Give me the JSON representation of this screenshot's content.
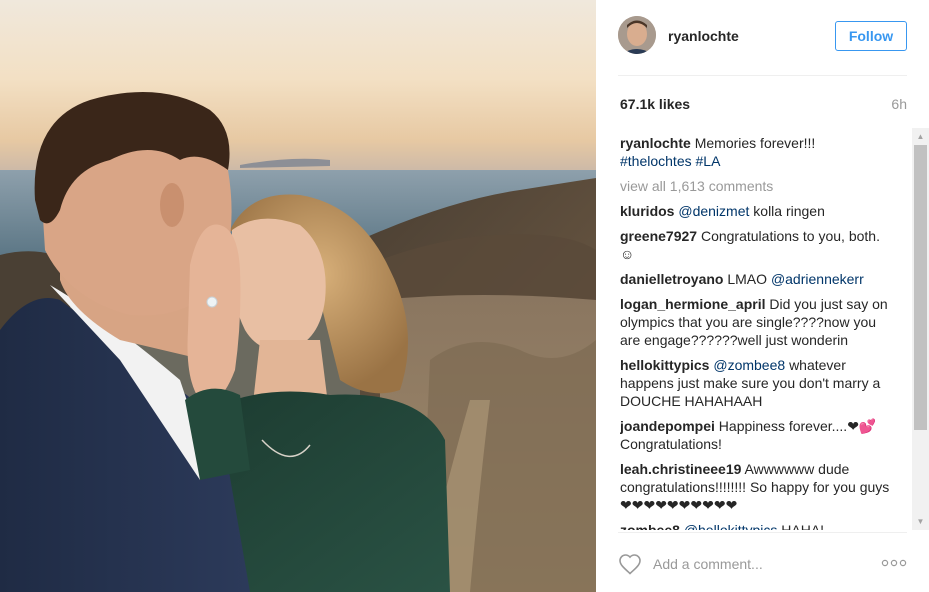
{
  "post": {
    "author": "ryanlochte",
    "follow_label": "Follow",
    "likes": "67.1k likes",
    "time": "6h",
    "add_comment_placeholder": "Add a comment...",
    "caption": {
      "user": "ryanlochte",
      "text": "Memories forever!!!",
      "hashtags": "#thelochtes #LA"
    },
    "view_all": "view all 1,613 comments",
    "comments": [
      {
        "user": "kluridos",
        "mention": "@denizmet",
        "text": "kolla ringen"
      },
      {
        "user": "greene7927",
        "mention": "",
        "text": "Congratulations to you, both.☺"
      },
      {
        "user": "danielletroyano",
        "mention": "",
        "text": "LMAO",
        "mention_after": "@adriennekerr"
      },
      {
        "user": "logan_hermione_april",
        "mention": "",
        "text": "Did you just say on olympics that you are single????now you are engage??????well just wonderin"
      },
      {
        "user": "hellokittypics",
        "mention": "@zombee8",
        "text": "whatever happens just make sure you don't marry a DOUCHE HAHAHAAH"
      },
      {
        "user": "joandepompei",
        "mention": "",
        "text": "Happiness forever....❤💕"
      },
      {
        "user": "",
        "mention": "",
        "text": "Congratulations!"
      },
      {
        "user": "leah.christineee19",
        "mention": "",
        "text": "Awwwwww dude congratulations!!!!!!!! So happy for you guys ❤❤❤❤❤❤❤❤❤❤"
      },
      {
        "user": "zombee8",
        "mention": "@hellokittypics",
        "text": "HAHA!"
      }
    ]
  },
  "icons": {
    "like": "heart-outline-icon",
    "more": "ellipsis-icon"
  },
  "colors": {
    "follow_blue": "#3897f0",
    "link_blue": "#003569",
    "muted": "#999999"
  }
}
